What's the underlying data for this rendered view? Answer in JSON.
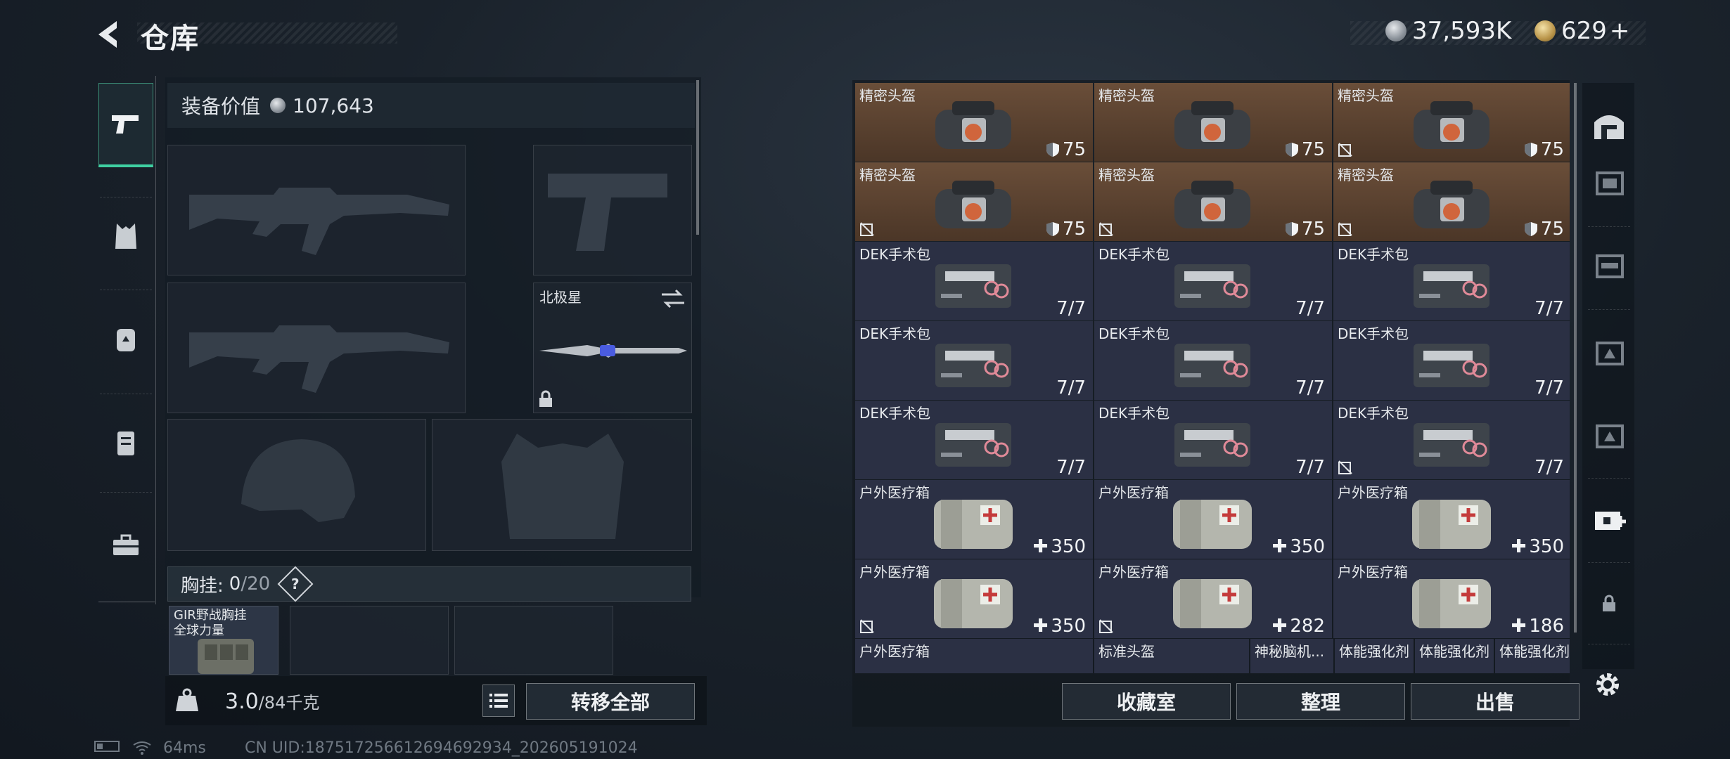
{
  "header": {
    "title": "仓库",
    "currency_silver": "37,593K",
    "currency_gold": "629",
    "add_symbol": "+"
  },
  "left_panel": {
    "equip_value_label": "装备价值",
    "equip_value": "107,643",
    "knife_name": "北极星",
    "vest_label": "胸挂:",
    "vest_count_used": "0",
    "vest_count_total": "/20",
    "help_mark": "?",
    "vest_item_name": "GIR野战胸挂",
    "vest_item_sub": "全球力量"
  },
  "left_bottom": {
    "weight": "3.0",
    "weight_cap": "/84千克",
    "transfer_all_label": "转移全部"
  },
  "grid": {
    "rows": [
      [
        {
          "name": "精密头盔",
          "qty": "75",
          "type": "helmet",
          "bg": "brown",
          "flag": false
        },
        {
          "name": "精密头盔",
          "qty": "75",
          "type": "helmet",
          "bg": "brown",
          "flag": false
        },
        {
          "name": "精密头盔",
          "qty": "75",
          "type": "helmet",
          "bg": "brown",
          "flag": true
        }
      ],
      [
        {
          "name": "精密头盔",
          "qty": "75",
          "type": "helmet",
          "bg": "brown",
          "flag": true
        },
        {
          "name": "精密头盔",
          "qty": "75",
          "type": "helmet",
          "bg": "brown",
          "flag": true
        },
        {
          "name": "精密头盔",
          "qty": "75",
          "type": "helmet",
          "bg": "brown",
          "flag": true
        }
      ],
      [
        {
          "name": "DEK手术包",
          "qty": "7/7",
          "type": "kit",
          "bg": "navy",
          "flag": false
        },
        {
          "name": "DEK手术包",
          "qty": "7/7",
          "type": "kit",
          "bg": "navy",
          "flag": false
        },
        {
          "name": "DEK手术包",
          "qty": "7/7",
          "type": "kit",
          "bg": "navy",
          "flag": false
        }
      ],
      [
        {
          "name": "DEK手术包",
          "qty": "7/7",
          "type": "kit",
          "bg": "navy",
          "flag": false
        },
        {
          "name": "DEK手术包",
          "qty": "7/7",
          "type": "kit",
          "bg": "navy",
          "flag": false
        },
        {
          "name": "DEK手术包",
          "qty": "7/7",
          "type": "kit",
          "bg": "navy",
          "flag": false
        }
      ],
      [
        {
          "name": "DEK手术包",
          "qty": "7/7",
          "type": "kit",
          "bg": "navy",
          "flag": false
        },
        {
          "name": "DEK手术包",
          "qty": "7/7",
          "type": "kit",
          "bg": "navy",
          "flag": false
        },
        {
          "name": "DEK手术包",
          "qty": "7/7",
          "type": "kit",
          "bg": "navy",
          "flag": true
        }
      ],
      [
        {
          "name": "户外医疗箱",
          "qty": "350",
          "type": "med",
          "bg": "navy",
          "flag": false
        },
        {
          "name": "户外医疗箱",
          "qty": "350",
          "type": "med",
          "bg": "navy",
          "flag": false
        },
        {
          "name": "户外医疗箱",
          "qty": "350",
          "type": "med",
          "bg": "navy",
          "flag": false
        }
      ],
      [
        {
          "name": "户外医疗箱",
          "qty": "350",
          "type": "med",
          "bg": "navy",
          "flag": true
        },
        {
          "name": "户外医疗箱",
          "qty": "282",
          "type": "med",
          "bg": "navy",
          "flag": true
        },
        {
          "name": "户外医疗箱",
          "qty": "186",
          "type": "med",
          "bg": "navy",
          "flag": false
        }
      ]
    ],
    "partial_row": [
      "户外医疗箱",
      "标准头盔",
      "神秘脑机...",
      "体能强化剂",
      "体能强化剂",
      "体能强化剂"
    ]
  },
  "grid_bottom": {
    "collection_label": "收藏室",
    "sort_label": "整理",
    "sell_label": "出售"
  },
  "status": {
    "ping": "64ms",
    "uid": "CN UID:18751725661269469293​4_202605191024"
  },
  "colors": {
    "accent": "#3fd0a2",
    "brown_cell": "#5a4231",
    "navy_cell": "#2b3044"
  }
}
